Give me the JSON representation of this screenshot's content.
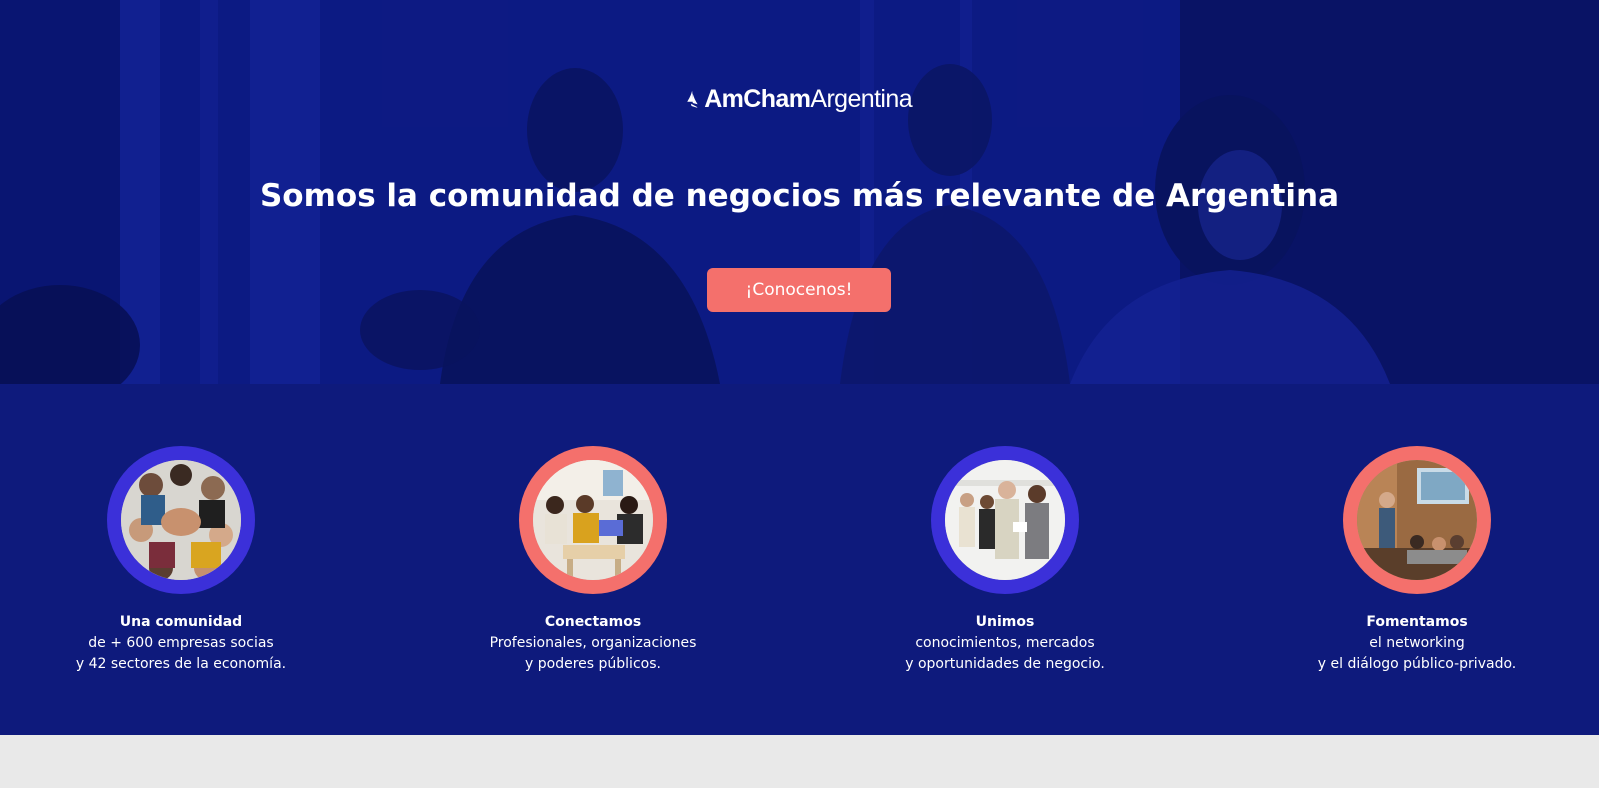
{
  "hero": {
    "logo": {
      "name_strong": "AmCham",
      "name_light": "Argentina",
      "icon": "sail-logo-icon"
    },
    "headline_strong": "Somos la comunidad de negocios",
    "headline_rest": " más relevante de Argentina",
    "cta_label": "¡Conocenos!"
  },
  "features": [
    {
      "title": "Una comunidad",
      "line1": "de + 600 empresas socias",
      "line2": "y 42 sectores de la economía.",
      "ring_color": "#3b30d9"
    },
    {
      "title": "Conectamos",
      "line1": "Profesionales, organizaciones",
      "line2": "y poderes públicos.",
      "ring_color": "#f4706c"
    },
    {
      "title": "Unimos",
      "line1": "conocimientos, mercados",
      "line2": "y oportunidades de negocio.",
      "ring_color": "#3b30d9"
    },
    {
      "title": "Fomentamos",
      "line1": "el networking",
      "line2": "y el diálogo público-privado.",
      "ring_color": "#f4706c"
    }
  ],
  "colors": {
    "hero_blue": "#12249a",
    "band_blue": "#0e1a7c",
    "coral": "#f4706c",
    "violet": "#3b30d9"
  }
}
